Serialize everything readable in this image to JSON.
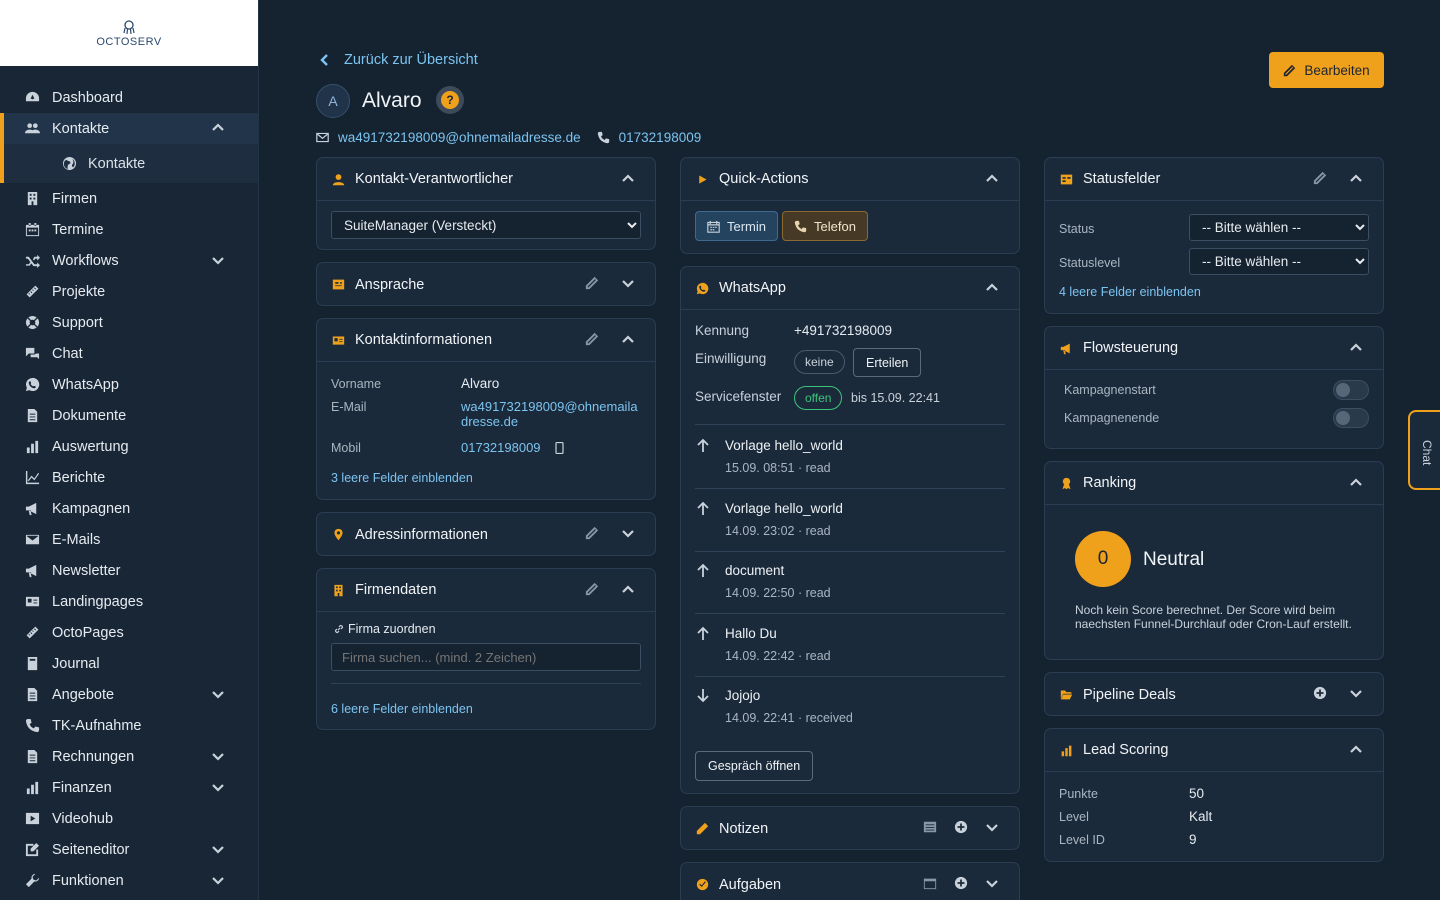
{
  "brand": {
    "name": "OCTOSERV"
  },
  "sidebar": {
    "items": [
      {
        "label": "Dashboard",
        "icon": "dashboard-icon"
      },
      {
        "label": "Kontakte",
        "icon": "users-icon",
        "expanded": true,
        "active": true
      },
      {
        "label": "Firmen",
        "icon": "building-icon"
      },
      {
        "label": "Termine",
        "icon": "calendar-icon"
      },
      {
        "label": "Workflows",
        "icon": "shuffle-icon",
        "expandable": true
      },
      {
        "label": "Projekte",
        "icon": "ruler-icon"
      },
      {
        "label": "Support",
        "icon": "lifebuoy-icon"
      },
      {
        "label": "Chat",
        "icon": "chat-icon"
      },
      {
        "label": "WhatsApp",
        "icon": "whatsapp-icon"
      },
      {
        "label": "Dokumente",
        "icon": "file-icon"
      },
      {
        "label": "Auswertung",
        "icon": "bar-chart-icon"
      },
      {
        "label": "Berichte",
        "icon": "line-chart-icon"
      },
      {
        "label": "Kampagnen",
        "icon": "megaphone-icon"
      },
      {
        "label": "E-Mails",
        "icon": "envelope-icon"
      },
      {
        "label": "Newsletter",
        "icon": "megaphone-icon"
      },
      {
        "label": "Landingpages",
        "icon": "id-card-icon"
      },
      {
        "label": "OctoPages",
        "icon": "ruler-icon"
      },
      {
        "label": "Journal",
        "icon": "book-icon"
      },
      {
        "label": "Angebote",
        "icon": "file-icon",
        "expandable": true
      },
      {
        "label": "TK-Aufnahme",
        "icon": "phone-icon"
      },
      {
        "label": "Rechnungen",
        "icon": "file-icon",
        "expandable": true
      },
      {
        "label": "Finanzen",
        "icon": "bar-chart-icon",
        "expandable": true
      },
      {
        "label": "Videohub",
        "icon": "video-icon"
      },
      {
        "label": "Seiteneditor",
        "icon": "edit-icon",
        "expandable": true
      },
      {
        "label": "Funktionen",
        "icon": "wrench-icon",
        "expandable": true
      }
    ],
    "sub_item": {
      "label": "Kontakte",
      "icon": "globe-icon"
    }
  },
  "header": {
    "back_label": "Zurück zur Übersicht",
    "avatar_letter": "A",
    "title": "Alvaro",
    "help": "?",
    "email": "wa491732198009@ohnemailadresse.de",
    "phone": "01732198009",
    "edit_label": "Bearbeiten"
  },
  "col1": {
    "verantwortlicher": {
      "title": "Kontakt-Verantwortlicher",
      "selected": "SuiteManager (Versteckt)"
    },
    "ansprache": {
      "title": "Ansprache"
    },
    "kontaktinfo": {
      "title": "Kontaktinformationen",
      "vorname_label": "Vorname",
      "vorname": "Alvaro",
      "email_label": "E-Mail",
      "email_line1": "wa491732198009@ohnemaila",
      "email_line2": "dresse.de",
      "mobil_label": "Mobil",
      "mobil": "01732198009",
      "empty_link": "3 leere Felder einblenden"
    },
    "adresse": {
      "title": "Adressinformationen"
    },
    "firmendaten": {
      "title": "Firmendaten",
      "assign_label": "Firma zuordnen",
      "search_placeholder": "Firma suchen... (mind. 2 Zeichen)",
      "empty_link": "6 leere Felder einblenden"
    }
  },
  "col2": {
    "quick": {
      "title": "Quick-Actions",
      "termin": "Termin",
      "telefon": "Telefon"
    },
    "whatsapp": {
      "title": "WhatsApp",
      "kennung_label": "Kennung",
      "kennung": "+491732198009",
      "einwilligung_label": "Einwilligung",
      "einwilligung_value": "keine",
      "erteilen": "Erteilen",
      "servicefenster_label": "Servicefenster",
      "servicefenster_status": "offen",
      "servicefenster_until": "bis 15.09. 22:41",
      "messages": [
        {
          "direction": "out",
          "text": "Vorlage hello_world",
          "meta": "15.09. 08:51 · read"
        },
        {
          "direction": "out",
          "text": "Vorlage hello_world",
          "meta": "14.09. 23:02 · read"
        },
        {
          "direction": "out",
          "text": "document",
          "meta": "14.09. 22:50 · read"
        },
        {
          "direction": "out",
          "text": "Hallo Du",
          "meta": "14.09. 22:42 · read"
        },
        {
          "direction": "in",
          "text": "Jojojo",
          "meta": "14.09. 22:41 · received"
        }
      ],
      "open_label": "Gespräch öffnen"
    },
    "notizen": {
      "title": "Notizen"
    },
    "aufgaben": {
      "title": "Aufgaben"
    }
  },
  "col3": {
    "status": {
      "title": "Statusfelder",
      "status_label": "Status",
      "status_value": "-- Bitte wählen --",
      "level_label": "Statuslevel",
      "level_value": "-- Bitte wählen --",
      "empty_link": "4 leere Felder einblenden"
    },
    "flow": {
      "title": "Flowsteuerung",
      "start_label": "Kampagnenstart",
      "end_label": "Kampagnenende"
    },
    "ranking": {
      "title": "Ranking",
      "score": "0",
      "label": "Neutral",
      "note_line1": "Noch kein Score berechnet. Der Score wird beim",
      "note_line2": "naechsten Funnel-Durchlauf oder Cron-Lauf erstellt."
    },
    "pipeline": {
      "title": "Pipeline Deals"
    },
    "lead": {
      "title": "Lead Scoring",
      "punkte_label": "Punkte",
      "punkte": "50",
      "level_label": "Level",
      "level": "Kalt",
      "levelid_label": "Level ID",
      "levelid": "9"
    }
  },
  "chat_tab": {
    "label": "Chat"
  },
  "colors": {
    "accent": "#f0a11c",
    "link": "#7cc4f0",
    "background": "#152230",
    "card": "#1b2a3b",
    "success": "#3cc47c"
  }
}
